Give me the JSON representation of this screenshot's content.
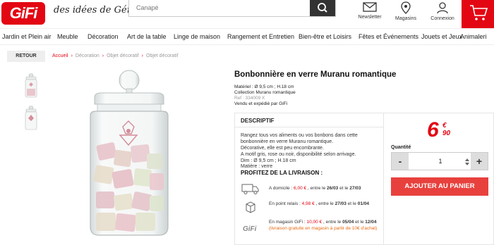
{
  "header": {
    "logo": "GiFi",
    "tagline": "des idées de Génie !",
    "search_placeholder": "Canapé",
    "newsletter": "Newsletter",
    "stores": "Magasins",
    "login": "Connexion"
  },
  "nav": [
    "Jardin et Plein air",
    "Meuble",
    "Décoration",
    "Art de la table",
    "Linge de maison",
    "Rangement et Entretien",
    "Bien-être et Loisirs",
    "Fêtes et Événements",
    "Jouets et Jeux",
    "Animaleri"
  ],
  "breadcrumb": {
    "back": "RETOUR",
    "items": [
      "Accueil",
      "Décoration",
      "Objet décoratif",
      "Objet décoratif"
    ]
  },
  "product": {
    "title": "Bonbonnière en verre Muranu romantique",
    "dimensions": "Matériel : Ø 9,5 cm ; H.18 cm",
    "collection": "Collection Muranu romantique",
    "ref": "Ref : 334009 X",
    "sold_by": "Vendu et expédié par GiFi"
  },
  "description": {
    "heading": "DESCRIPTIF",
    "lines": [
      "Rangez tous vos aliments ou vos bonbons dans cette",
      "bonbonnière en verre Muranu romantique.",
      "Décorative, elle est peu encombrante.",
      "A motif gris, rose ou noir, disponibilité selon arrivage.",
      "Dim : Ø 9,5 cm ; H.18 cm",
      "Matière : verre"
    ],
    "profitez": "PROFITEZ DE LA LIVRAISON :"
  },
  "delivery": [
    {
      "label": "A domicile : ",
      "price": "6,00 €",
      "mid": " , entre le ",
      "d1": "26/03",
      "and": " et le ",
      "d2": "27/03"
    },
    {
      "label": "En point relais : ",
      "price": "4,98 €",
      "mid": " , entre le ",
      "d1": "27/03",
      "and": " et le ",
      "d2": "01/04"
    },
    {
      "label": "En magasin GiFi : ",
      "price": "10,00 €",
      "mid": " , entre le ",
      "d1": "05/04",
      "and": " et le ",
      "d2": "12/04",
      "note": "(livraison gratuite en magasin à partir de 10€ d'achat)"
    }
  ],
  "buy": {
    "price_int": "6",
    "price_cents": "90",
    "price_currency": "€",
    "qty_label": "Quantité",
    "qty_value": "1",
    "minus": "-",
    "plus": "+",
    "add_to_cart": "AJOUTER AU PANIER"
  },
  "colors": {
    "brand": "#e30613",
    "button": "#e8413d",
    "note": "#e86a10"
  }
}
